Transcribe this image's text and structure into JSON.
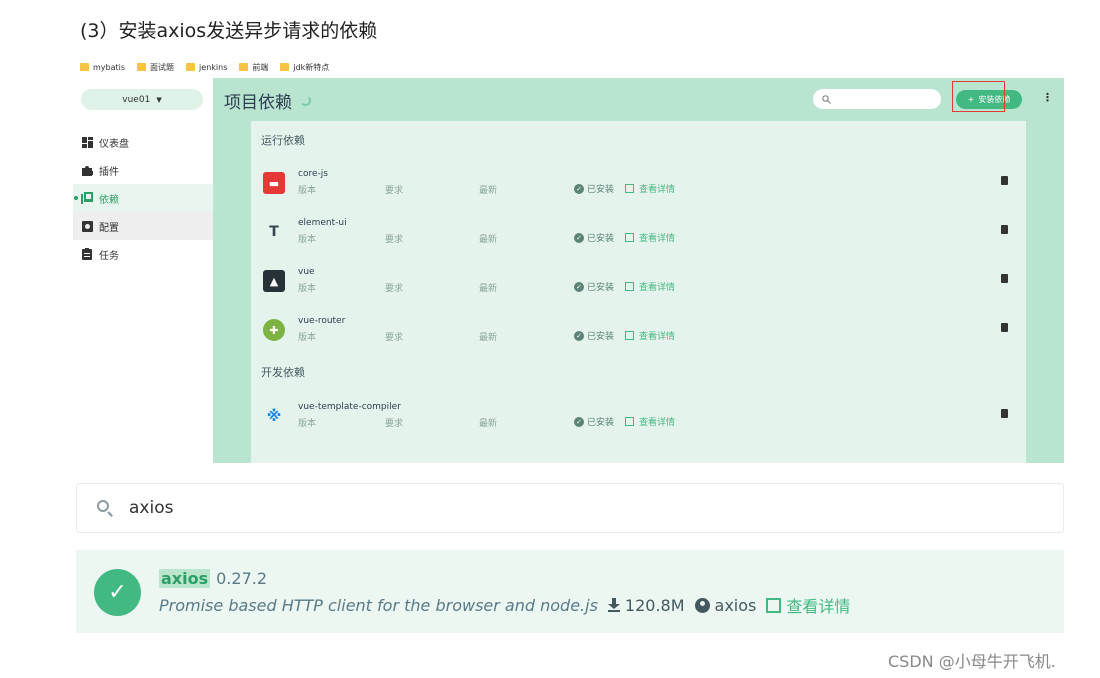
{
  "heading": "(3）安装axios发送异步请求的依赖",
  "bookmarks": [
    "mybatis",
    "面试题",
    "jenkins",
    "前端",
    "jdk新特点"
  ],
  "sidebar": {
    "project": "vue01",
    "items": [
      {
        "label": "仪表盘"
      },
      {
        "label": "插件"
      },
      {
        "label": "依赖"
      },
      {
        "label": "配置"
      },
      {
        "label": "任务"
      }
    ],
    "tooltip": "配置"
  },
  "main": {
    "title": "项目依赖",
    "install_label": "安装依赖",
    "runtime_title": "运行依赖",
    "dev_title": "开发依赖",
    "col_version": "版本",
    "col_required": "要求",
    "col_latest": "最新",
    "installed": "已安装",
    "details": "查看详情",
    "runtime_deps": [
      {
        "name": "core-js",
        "icon_color": "#e53935"
      },
      {
        "name": "element-ui",
        "icon_color": "#37474f"
      },
      {
        "name": "vue",
        "icon_color": "#263238"
      },
      {
        "name": "vue-router",
        "icon_color": "#7cb342"
      }
    ],
    "dev_deps": [
      {
        "name": "vue-template-compiler",
        "icon_color": "#1e88e5"
      }
    ]
  },
  "search": {
    "query": "axios"
  },
  "result": {
    "name": "axios",
    "version": "0.27.2",
    "description": "Promise based HTTP client for the browser and node.js",
    "downloads": "120.8M",
    "author": "axios",
    "details": "查看详情"
  },
  "watermark": "CSDN @小母牛开飞机."
}
